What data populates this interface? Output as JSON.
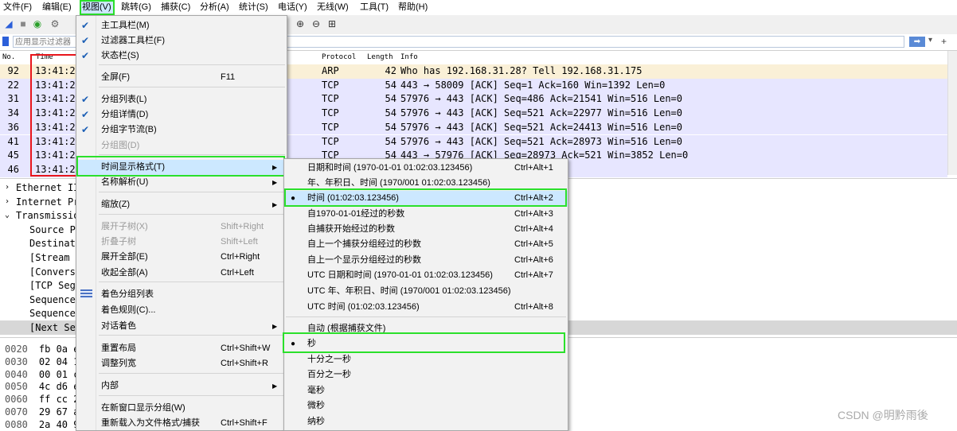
{
  "menubar": [
    "文件(F)",
    "编辑(E)",
    "视图(V)",
    "跳转(G)",
    "捕获(C)",
    "分析(A)",
    "统计(S)",
    "电话(Y)",
    "无线(W)",
    "工具(T)",
    "帮助(H)"
  ],
  "filter": {
    "placeholder": "应用显示过滤器"
  },
  "packet_list": {
    "headers": {
      "no": "No.",
      "time": "Time",
      "protocol": "Protocol",
      "length": "Length",
      "info": "Info"
    },
    "rows": [
      {
        "no": "92",
        "time": "13:41:2",
        "protocol": "ARP",
        "length": "42",
        "info": "Who has 192.168.31.28? Tell 192.168.31.175"
      },
      {
        "no": "22",
        "time": "13:41:2",
        "protocol": "TCP",
        "length": "54",
        "info": "443 → 58009 [ACK] Seq=1 Ack=160 Win=1392 Len=0"
      },
      {
        "no": "31",
        "time": "13:41:2",
        "protocol": "TCP",
        "length": "54",
        "info": "57976 → 443 [ACK] Seq=486 Ack=21541 Win=516 Len=0"
      },
      {
        "no": "34",
        "time": "13:41:2",
        "protocol": "TCP",
        "length": "54",
        "info": "57976 → 443 [ACK] Seq=521 Ack=22977 Win=516 Len=0"
      },
      {
        "no": "36",
        "time": "13:41:2",
        "protocol": "TCP",
        "length": "54",
        "info": "57976 → 443 [ACK] Seq=521 Ack=24413 Win=516 Len=0"
      },
      {
        "no": "41",
        "time": "13:41:2",
        "protocol": "TCP",
        "length": "54",
        "info": "57976 → 443 [ACK] Seq=521 Ack=28973 Win=516 Len=0"
      },
      {
        "no": "45",
        "time": "13:41:2",
        "protocol": "TCP",
        "length": "54",
        "info": "443 → 57976 [ACK] Seq=28973 Ack=521 Win=3852 Len=0"
      },
      {
        "no": "46",
        "time": "13:41:2",
        "protocol": "",
        "length": "",
        "info": "8 Win=1392 Len=0"
      }
    ]
  },
  "details": [
    "Ethernet II",
    "Internet Pr",
    "Transmissio",
    "Source P",
    "Destinat",
    "[Stream",
    "[Convers",
    "[TCP Seg",
    "Sequence",
    "Sequence",
    "[Next Se"
  ],
  "bytes": [
    {
      "off": "0020",
      "hex": "fb 0a e"
    },
    {
      "off": "0030",
      "hex": "02 04 1"
    },
    {
      "off": "0040",
      "hex": "00 01 c"
    },
    {
      "off": "0050",
      "hex": "4c d6 e"
    },
    {
      "off": "0060",
      "hex": "ff cc 2"
    },
    {
      "off": "0070",
      "hex": "29 67 a"
    },
    {
      "off": "0080",
      "hex": "2a 40 9"
    }
  ],
  "view_menu": [
    {
      "label": "主工具栏(M)",
      "checked": true
    },
    {
      "label": "过滤器工具栏(F)",
      "checked": true
    },
    {
      "label": "状态栏(S)",
      "checked": true
    },
    {
      "label": "全屏(F)",
      "shortcut": "F11"
    },
    {
      "label": "分组列表(L)",
      "checked": true
    },
    {
      "label": "分组详情(D)",
      "checked": true
    },
    {
      "label": "分组字节流(B)",
      "checked": true
    },
    {
      "label": "分组图(D)",
      "disabled": true
    },
    {
      "label": "时间显示格式(T)",
      "submenu": true
    },
    {
      "label": "名称解析(U)",
      "submenu": true
    },
    {
      "label": "缩放(Z)",
      "submenu": true
    },
    {
      "label": "展开子树(X)",
      "shortcut": "Shift+Right",
      "disabled": true
    },
    {
      "label": "折叠子树",
      "shortcut": "Shift+Left",
      "disabled": true
    },
    {
      "label": "展开全部(E)",
      "shortcut": "Ctrl+Right"
    },
    {
      "label": "收起全部(A)",
      "shortcut": "Ctrl+Left"
    },
    {
      "label": "着色分组列表"
    },
    {
      "label": "着色规则(C)..."
    },
    {
      "label": "对话着色",
      "submenu": true
    },
    {
      "label": "重置布局",
      "shortcut": "Ctrl+Shift+W"
    },
    {
      "label": "调整列宽",
      "shortcut": "Ctrl+Shift+R"
    },
    {
      "label": "内部",
      "submenu": true
    },
    {
      "label": "在新窗口显示分组(W)"
    },
    {
      "label": "重新载入为文件格式/捕获",
      "shortcut": "Ctrl+Shift+F"
    }
  ],
  "time_format_menu": [
    {
      "label": "日期和时间 (1970-01-01 01:02:03.123456)",
      "shortcut": "Ctrl+Alt+1"
    },
    {
      "label": "年、年积日、时间 (1970/001 01:02:03.123456)"
    },
    {
      "label": "时间 (01:02:03.123456)",
      "shortcut": "Ctrl+Alt+2",
      "selected": true
    },
    {
      "label": "自1970-01-01经过的秒数",
      "shortcut": "Ctrl+Alt+3"
    },
    {
      "label": "自捕获开始经过的秒数",
      "shortcut": "Ctrl+Alt+4"
    },
    {
      "label": "自上一个捕获分组经过的秒数",
      "shortcut": "Ctrl+Alt+5"
    },
    {
      "label": "自上一个显示分组经过的秒数",
      "shortcut": "Ctrl+Alt+6"
    },
    {
      "label": "UTC 日期和时间 (1970-01-01 01:02:03.123456)",
      "shortcut": "Ctrl+Alt+7"
    },
    {
      "label": "UTC 年、年积日、时间 (1970/001 01:02:03.123456)"
    },
    {
      "label": "UTC 时间 (01:02:03.123456)",
      "shortcut": "Ctrl+Alt+8"
    },
    {
      "label": "自动 (根据捕获文件)"
    },
    {
      "label": "秒",
      "selected": true
    },
    {
      "label": "十分之一秒"
    },
    {
      "label": "百分之一秒"
    },
    {
      "label": "毫秒"
    },
    {
      "label": "微秒"
    },
    {
      "label": "纳秒"
    }
  ],
  "watermark": "CSDN @明黔雨後",
  "colors": {
    "highlight": "#cce8ff",
    "annot_green": "#2be02b",
    "annot_red": "#e8151b",
    "tcp_row": "#e7e6ff",
    "arp_row": "#faf0d7"
  }
}
